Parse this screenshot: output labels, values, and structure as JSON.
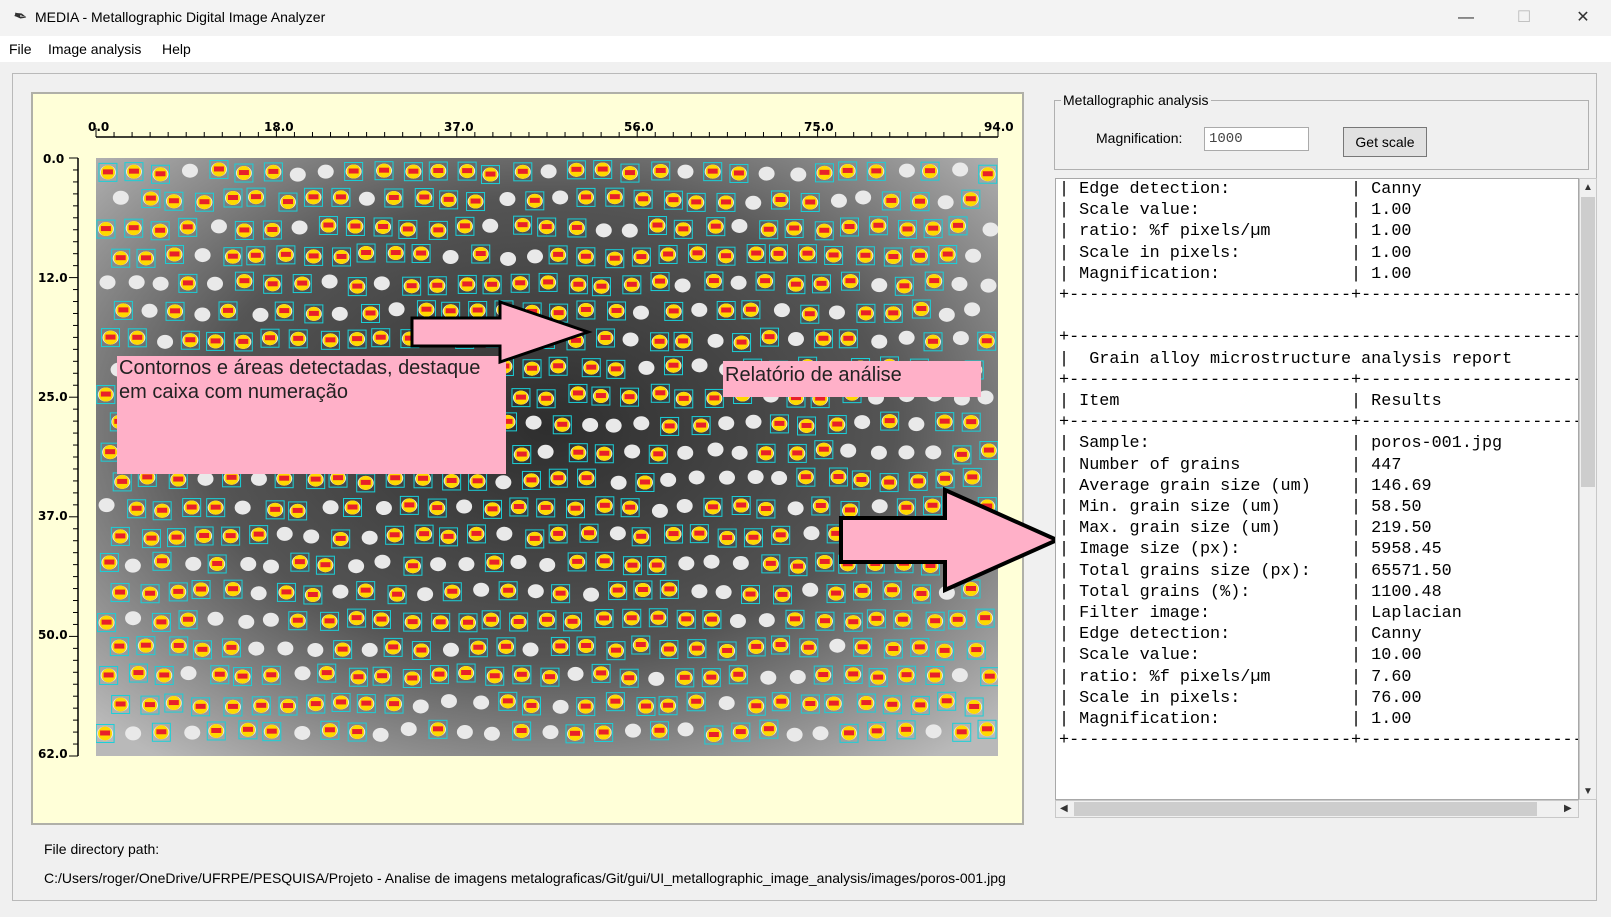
{
  "window": {
    "title": "MEDIA - Metallographic Digital Image Analyzer",
    "icon": "feather-icon",
    "minimize": "—",
    "maximize": "☐",
    "close": "✕"
  },
  "menu": [
    "File",
    "Image analysis",
    "Help"
  ],
  "axes": {
    "x_ticks": [
      "0.0",
      "18.0",
      "37.0",
      "56.0",
      "75.0",
      "94.0"
    ],
    "y_ticks": [
      "0.0",
      "12.0",
      "25.0",
      "37.0",
      "50.0",
      "62.0"
    ]
  },
  "annotations": {
    "contours": "Contornos e áreas detectadas, destaque em caixa com numeração",
    "report": "Relatório de análise"
  },
  "analysis": {
    "group_title": "Metallographic analysis",
    "magnification_label": "Magnification:",
    "magnification_value": "1000",
    "get_scale_button": "Get scale"
  },
  "report_text": "| Edge detection:            | Canny\n| Scale value:               | 1.00\n| ratio: %f pixels/µm        | 1.00\n| Scale in pixels:           | 1.00\n| Magnification:             | 1.00\n+----------------------------+-----------------------\n\n+----------------------------------------------------\n|  Grain alloy microstructure analysis report\n+----------------------------+-----------------------\n| Item                       | Results\n+----------------------------+-----------------------\n| Sample:                    | poros-001.jpg\n| Number of grains           | 447\n| Average grain size (um)    | 146.69\n| Min. grain size (um)       | 58.50\n| Max. grain size (um)       | 219.50\n| Image size (px):           | 5958.45\n| Total grains size (px):    | 65571.50\n| Total grains (%):          | 1100.48\n| Filter image:              | Laplacian\n| Edge detection:            | Canny\n| Scale value:               | 10.00\n| ratio: %f pixels/µm        | 7.60\n| Scale in pixels:           | 76.00\n| Magnification:             | 1.00\n+----------------------------+-----------------------",
  "file_path": {
    "label": "File directory path:",
    "value": "C:/Users/roger/OneDrive/UFRPE/PESQUISA/Projeto - Analise de imagens metalograficas/Git/gui/UI_metallographic_image_analysis/images/poros-001.jpg"
  }
}
